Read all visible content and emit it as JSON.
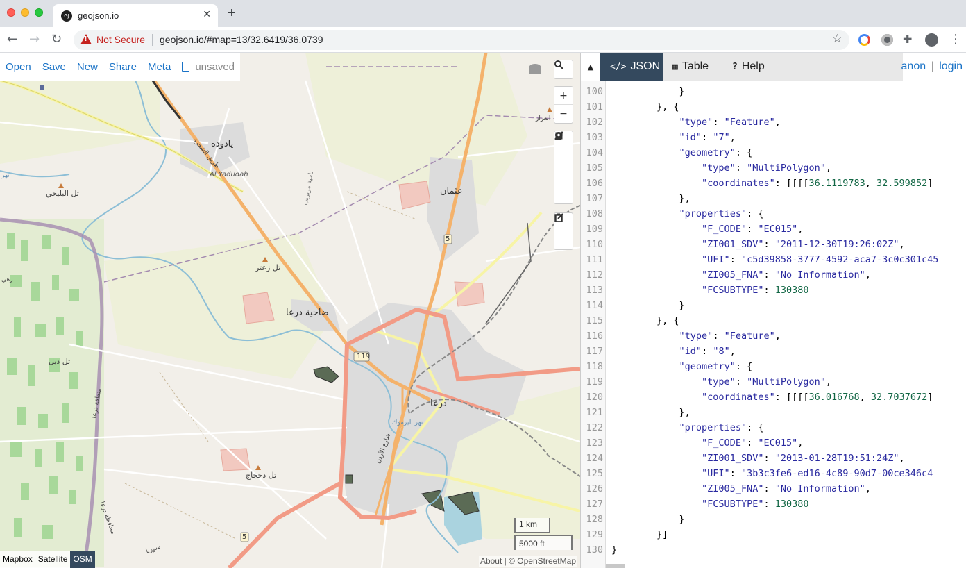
{
  "browser": {
    "tab_title": "geojson.io",
    "favicon_text": "GJ",
    "url": "geojson.io/#map=13/32.6419/36.0739",
    "security_label": "Not Secure"
  },
  "file_menu": {
    "items": [
      "Open",
      "Save",
      "New",
      "Share",
      "Meta"
    ],
    "status": "unsaved"
  },
  "map": {
    "labels": {
      "yadudah_ar": "يادودة",
      "yadudah_road": "طريق الشجرة",
      "yadudah_en": "Al Yadudah",
      "tell_bilikhi": "تل البليخي",
      "nahiya": "ناحية مزيريب",
      "tell_zatar": "تل زعتر",
      "dahiyat_daraa": "ضاحية درعا",
      "uthman": "عثمان",
      "arar": "العرار",
      "tell_dhibl": "تل ذيل",
      "daraa_region": "منطقة درعا",
      "daraa": "درعا",
      "tell_dahhaj": "تل دحجاج",
      "daraa_gov": "محافظة درعا",
      "syria": "سوريا",
      "jordan_road": "شارع الأردن",
      "road_119": "119",
      "road_5_north": "5",
      "road_5_south": "5",
      "river": "نهر اليرموك",
      "west_edge_1": "رهي",
      "west_edge_2": "نهر"
    },
    "scale_km": "1 km",
    "scale_ft": "5000 ft",
    "layers": [
      "Mapbox",
      "Satellite",
      "OSM"
    ],
    "active_layer": "OSM",
    "attribution": "About | © OpenStreetMap"
  },
  "tools": {
    "search": "search-icon",
    "zoom": [
      "+",
      "−"
    ],
    "draw": [
      "line-icon",
      "polygon-icon",
      "rectangle-icon",
      "marker-icon"
    ],
    "edit": [
      "edit-icon",
      "trash-icon"
    ]
  },
  "pane": {
    "tabs": [
      {
        "icon": "</>",
        "label": "JSON"
      },
      {
        "icon": "▦",
        "label": "Table"
      },
      {
        "icon": "?",
        "label": "Help"
      }
    ],
    "user": {
      "anon": "anon",
      "sep": "|",
      "login": "login"
    }
  },
  "code_lines": [
    {
      "n": "100",
      "indent": 12,
      "parts": [
        [
          "p",
          "}"
        ]
      ]
    },
    {
      "n": "101",
      "indent": 8,
      "parts": [
        [
          "p",
          "}, {"
        ]
      ]
    },
    {
      "n": "102",
      "indent": 12,
      "parts": [
        [
          "k",
          "\"type\""
        ],
        [
          "p",
          ": "
        ],
        [
          "s",
          "\"Feature\""
        ],
        [
          "p",
          ","
        ]
      ]
    },
    {
      "n": "103",
      "indent": 12,
      "parts": [
        [
          "k",
          "\"id\""
        ],
        [
          "p",
          ": "
        ],
        [
          "s",
          "\"7\""
        ],
        [
          "p",
          ","
        ]
      ]
    },
    {
      "n": "104",
      "indent": 12,
      "parts": [
        [
          "k",
          "\"geometry\""
        ],
        [
          "p",
          ": {"
        ]
      ]
    },
    {
      "n": "105",
      "indent": 16,
      "parts": [
        [
          "k",
          "\"type\""
        ],
        [
          "p",
          ": "
        ],
        [
          "s",
          "\"MultiPolygon\""
        ],
        [
          "p",
          ","
        ]
      ]
    },
    {
      "n": "106",
      "indent": 16,
      "parts": [
        [
          "k",
          "\"coordinates\""
        ],
        [
          "p",
          ": [[[["
        ],
        [
          "n",
          "36.1119783"
        ],
        [
          "p",
          ", "
        ],
        [
          "n",
          "32.599852"
        ],
        [
          "p",
          "]"
        ]
      ]
    },
    {
      "n": "107",
      "indent": 12,
      "parts": [
        [
          "p",
          "},"
        ]
      ]
    },
    {
      "n": "108",
      "indent": 12,
      "parts": [
        [
          "k",
          "\"properties\""
        ],
        [
          "p",
          ": {"
        ]
      ]
    },
    {
      "n": "109",
      "indent": 16,
      "parts": [
        [
          "k",
          "\"F_CODE\""
        ],
        [
          "p",
          ": "
        ],
        [
          "s",
          "\"EC015\""
        ],
        [
          "p",
          ","
        ]
      ]
    },
    {
      "n": "110",
      "indent": 16,
      "parts": [
        [
          "k",
          "\"ZI001_SDV\""
        ],
        [
          "p",
          ": "
        ],
        [
          "s",
          "\"2011-12-30T19:26:02Z\""
        ],
        [
          "p",
          ","
        ]
      ]
    },
    {
      "n": "111",
      "indent": 16,
      "parts": [
        [
          "k",
          "\"UFI\""
        ],
        [
          "p",
          ": "
        ],
        [
          "s",
          "\"c5d39858-3777-4592-aca7-3c0c301c45"
        ]
      ]
    },
    {
      "n": "112",
      "indent": 16,
      "parts": [
        [
          "k",
          "\"ZI005_FNA\""
        ],
        [
          "p",
          ": "
        ],
        [
          "s",
          "\"No Information\""
        ],
        [
          "p",
          ","
        ]
      ]
    },
    {
      "n": "113",
      "indent": 16,
      "parts": [
        [
          "k",
          "\"FCSUBTYPE\""
        ],
        [
          "p",
          ": "
        ],
        [
          "n",
          "130380"
        ]
      ]
    },
    {
      "n": "114",
      "indent": 12,
      "parts": [
        [
          "p",
          "}"
        ]
      ]
    },
    {
      "n": "115",
      "indent": 8,
      "parts": [
        [
          "p",
          "}, {"
        ]
      ]
    },
    {
      "n": "116",
      "indent": 12,
      "parts": [
        [
          "k",
          "\"type\""
        ],
        [
          "p",
          ": "
        ],
        [
          "s",
          "\"Feature\""
        ],
        [
          "p",
          ","
        ]
      ]
    },
    {
      "n": "117",
      "indent": 12,
      "parts": [
        [
          "k",
          "\"id\""
        ],
        [
          "p",
          ": "
        ],
        [
          "s",
          "\"8\""
        ],
        [
          "p",
          ","
        ]
      ]
    },
    {
      "n": "118",
      "indent": 12,
      "parts": [
        [
          "k",
          "\"geometry\""
        ],
        [
          "p",
          ": {"
        ]
      ]
    },
    {
      "n": "119",
      "indent": 16,
      "parts": [
        [
          "k",
          "\"type\""
        ],
        [
          "p",
          ": "
        ],
        [
          "s",
          "\"MultiPolygon\""
        ],
        [
          "p",
          ","
        ]
      ]
    },
    {
      "n": "120",
      "indent": 16,
      "parts": [
        [
          "k",
          "\"coordinates\""
        ],
        [
          "p",
          ": [[[["
        ],
        [
          "n",
          "36.016768"
        ],
        [
          "p",
          ", "
        ],
        [
          "n",
          "32.7037672"
        ],
        [
          "p",
          "]"
        ]
      ]
    },
    {
      "n": "121",
      "indent": 12,
      "parts": [
        [
          "p",
          "},"
        ]
      ]
    },
    {
      "n": "122",
      "indent": 12,
      "parts": [
        [
          "k",
          "\"properties\""
        ],
        [
          "p",
          ": {"
        ]
      ]
    },
    {
      "n": "123",
      "indent": 16,
      "parts": [
        [
          "k",
          "\"F_CODE\""
        ],
        [
          "p",
          ": "
        ],
        [
          "s",
          "\"EC015\""
        ],
        [
          "p",
          ","
        ]
      ]
    },
    {
      "n": "124",
      "indent": 16,
      "parts": [
        [
          "k",
          "\"ZI001_SDV\""
        ],
        [
          "p",
          ": "
        ],
        [
          "s",
          "\"2013-01-28T19:51:24Z\""
        ],
        [
          "p",
          ","
        ]
      ]
    },
    {
      "n": "125",
      "indent": 16,
      "parts": [
        [
          "k",
          "\"UFI\""
        ],
        [
          "p",
          ": "
        ],
        [
          "s",
          "\"3b3c3fe6-ed16-4c89-90d7-00ce346c4"
        ]
      ]
    },
    {
      "n": "126",
      "indent": 16,
      "parts": [
        [
          "k",
          "\"ZI005_FNA\""
        ],
        [
          "p",
          ": "
        ],
        [
          "s",
          "\"No Information\""
        ],
        [
          "p",
          ","
        ]
      ]
    },
    {
      "n": "127",
      "indent": 16,
      "parts": [
        [
          "k",
          "\"FCSUBTYPE\""
        ],
        [
          "p",
          ": "
        ],
        [
          "n",
          "130380"
        ]
      ]
    },
    {
      "n": "128",
      "indent": 12,
      "parts": [
        [
          "p",
          "}"
        ]
      ]
    },
    {
      "n": "129",
      "indent": 8,
      "parts": [
        [
          "p",
          "}]"
        ]
      ]
    },
    {
      "n": "130",
      "indent": 0,
      "parts": [
        [
          "p",
          "}"
        ]
      ]
    }
  ]
}
